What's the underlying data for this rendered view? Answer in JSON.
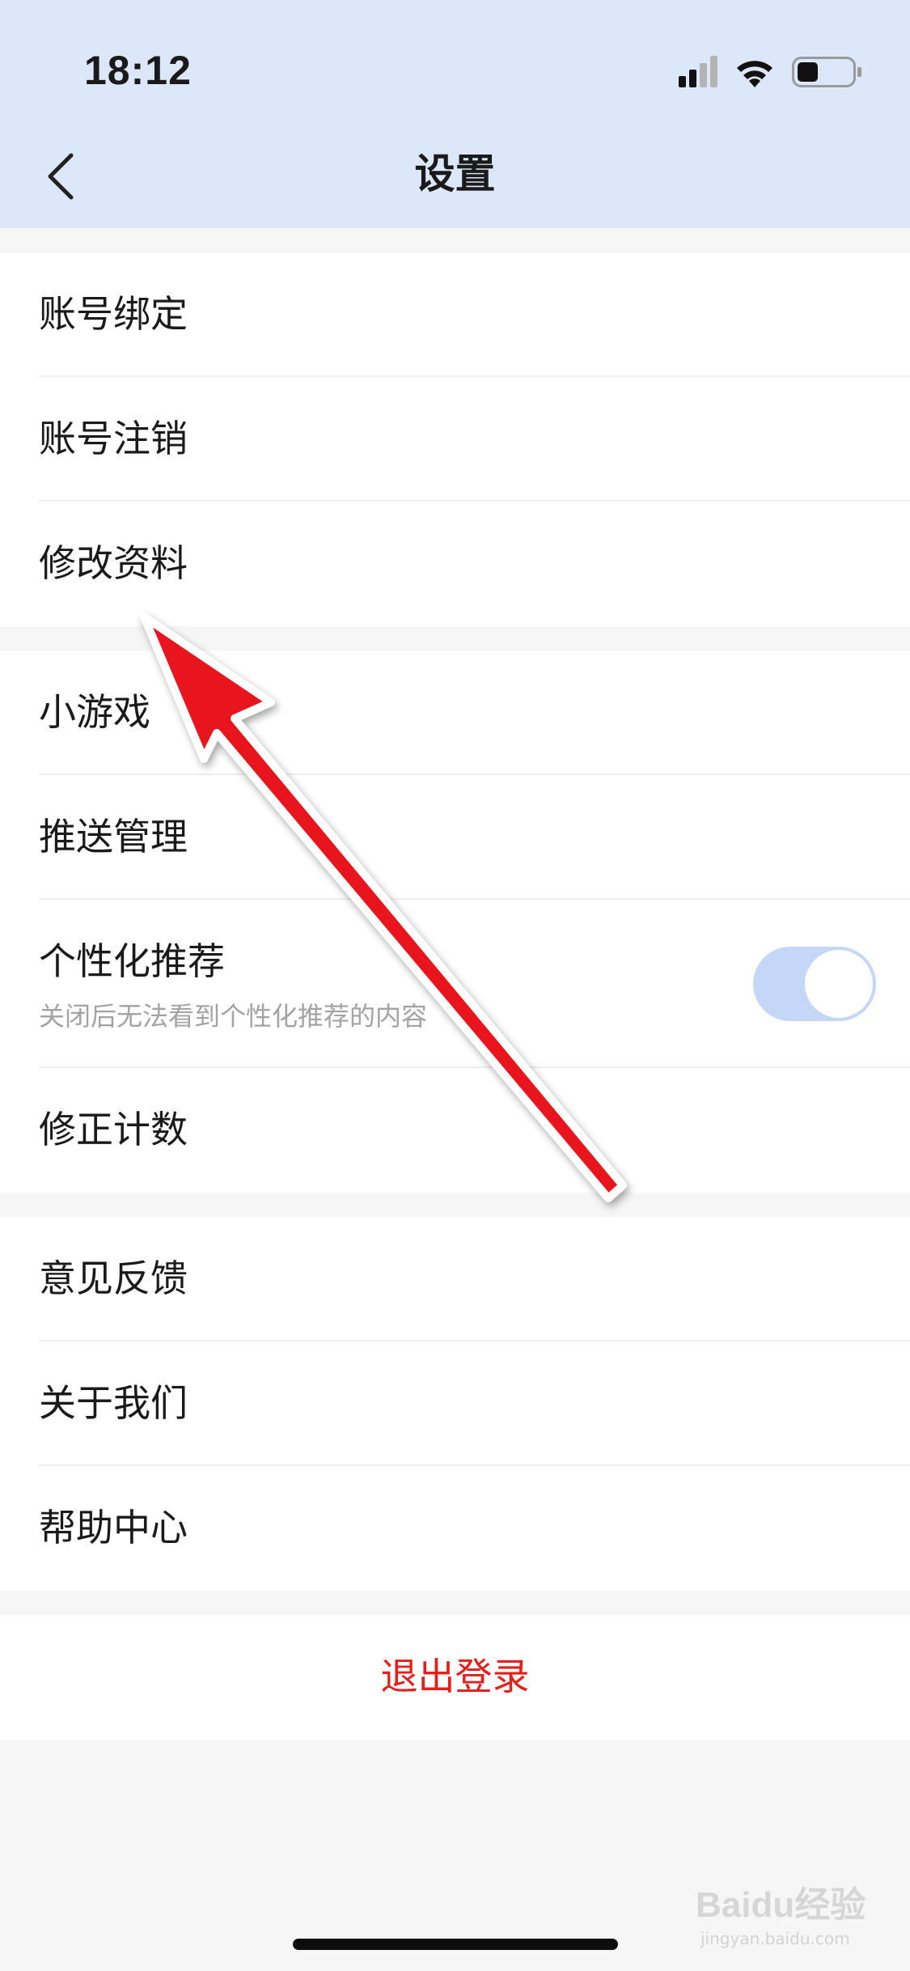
{
  "status_bar": {
    "time": "18:12",
    "icons": [
      "signal-icon",
      "wifi-icon",
      "battery-icon"
    ]
  },
  "header": {
    "title": "设置",
    "back_icon": "chevron-left-icon",
    "background": "#dde7fa"
  },
  "groups": [
    {
      "items": [
        {
          "label": "账号绑定"
        },
        {
          "label": "账号注销"
        },
        {
          "label": "修改资料"
        }
      ]
    },
    {
      "items": [
        {
          "label": "小游戏"
        },
        {
          "label": "推送管理"
        },
        {
          "label": "个性化推荐",
          "subtitle": "关闭后无法看到个性化推荐的内容",
          "toggle": true
        },
        {
          "label": "修正计数"
        }
      ]
    },
    {
      "items": [
        {
          "label": "意见反馈"
        },
        {
          "label": "关于我们"
        },
        {
          "label": "帮助中心"
        }
      ]
    }
  ],
  "logout": {
    "label": "退出登录",
    "color": "#e2201c"
  },
  "annotation": {
    "type": "arrow",
    "color": "#e8141c"
  },
  "watermark": {
    "text": "Baidu经验",
    "sub": "jingyan.baidu.com"
  }
}
